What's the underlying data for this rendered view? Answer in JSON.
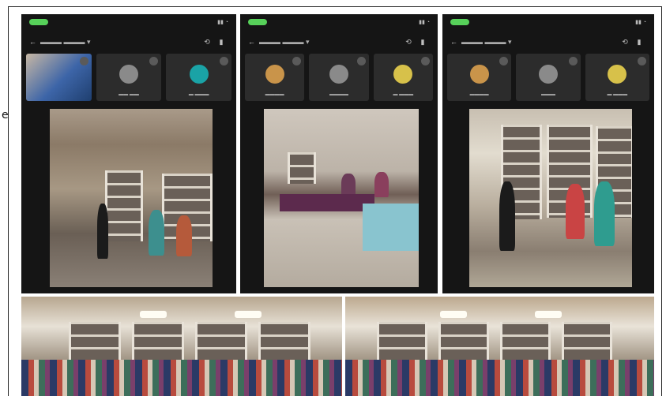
{
  "screens": [
    {
      "tiles": [
        {
          "kind": "photo"
        },
        {
          "kind": "avatar",
          "color": "#8a8a8a"
        },
        {
          "kind": "avatar",
          "color": "#1aa3a6"
        }
      ],
      "room": "room1"
    },
    {
      "tiles": [
        {
          "kind": "avatar",
          "color": "#c9944a"
        },
        {
          "kind": "avatar",
          "color": "#8a8a8a"
        },
        {
          "kind": "avatar",
          "color": "#d7c14a"
        }
      ],
      "room": "room2"
    },
    {
      "tiles": [
        {
          "kind": "avatar",
          "color": "#c9944a"
        },
        {
          "kind": "avatar",
          "color": "#8a8a8a"
        },
        {
          "kind": "avatar",
          "color": "#d7c14a"
        }
      ],
      "room": "room3"
    }
  ],
  "colors": {
    "status_pill": "#57d15a",
    "call_bg": "#151515",
    "tile_bg": "#2c2c2c"
  },
  "icons": [
    "back-arrow-icon",
    "camera-switch-icon",
    "speaker-icon",
    "mic-muted-icon"
  ]
}
